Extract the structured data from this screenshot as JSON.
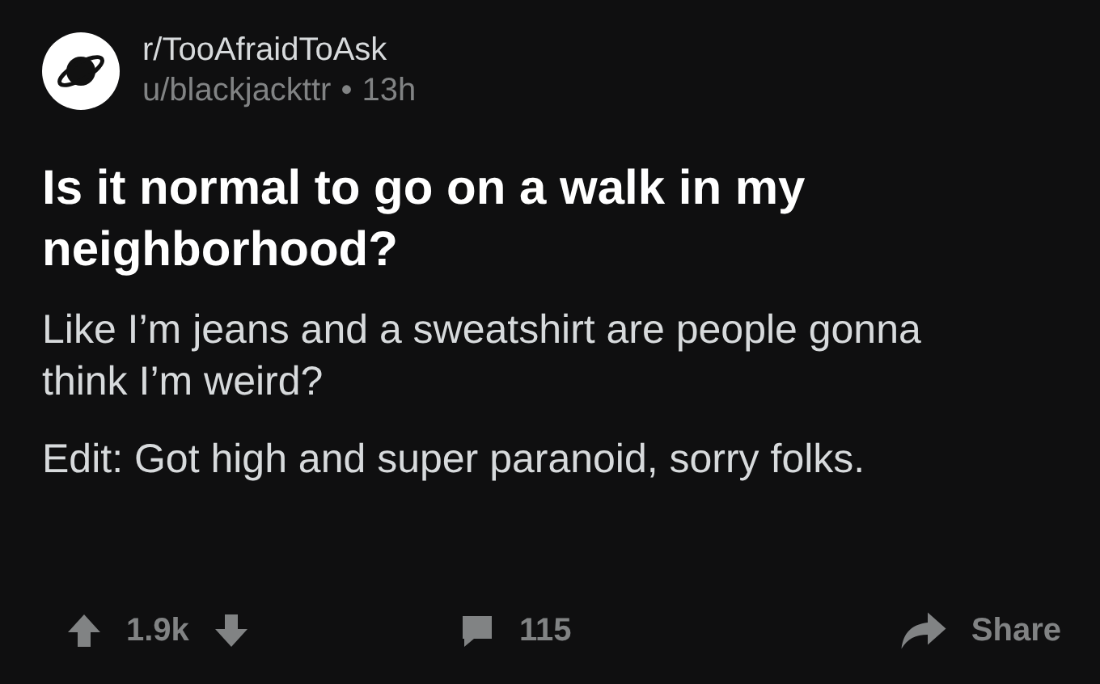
{
  "post": {
    "subreddit": "r/TooAfraidToAsk",
    "author": "u/blackjackttr",
    "separator": "•",
    "age": "13h",
    "title": "Is it normal to go on a walk in my neighborhood?",
    "body": [
      "Like I’m jeans and a sweatshirt are people gonna think I’m weird?",
      "Edit: Got high and super paranoid, sorry folks."
    ]
  },
  "actions": {
    "score": "1.9k",
    "comments": "115",
    "share": "Share"
  }
}
